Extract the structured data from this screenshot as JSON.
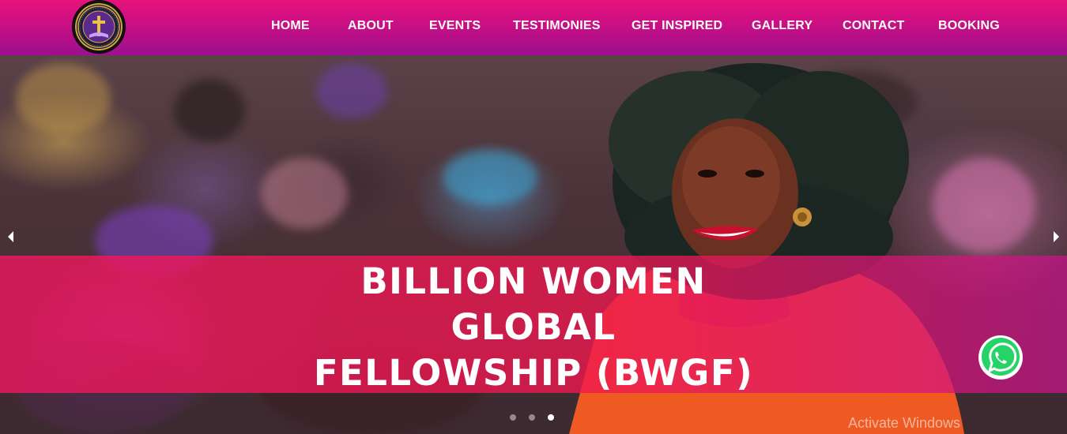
{
  "nav": {
    "items": [
      {
        "label": "HOME"
      },
      {
        "label": "ABOUT"
      },
      {
        "label": "EVENTS"
      },
      {
        "label": "TESTIMONIES"
      },
      {
        "label": "GET INSPIRED"
      },
      {
        "label": "GALLERY"
      },
      {
        "label": "CONTACT"
      },
      {
        "label": "BOOKING"
      }
    ]
  },
  "hero": {
    "caption_lines": [
      "BILLION WOMEN",
      "GLOBAL",
      "FELLOWSHIP (BWGF)"
    ],
    "slides_total": 3,
    "active_slide": 3
  },
  "watermark": "Activate Windows",
  "icons": {
    "logo": "bwgf-logo-icon",
    "prev": "chevron-left-icon",
    "next": "chevron-right-icon",
    "whatsapp": "whatsapp-icon"
  },
  "colors": {
    "header_top": "#e8127a",
    "header_bottom": "#9c0f8e",
    "caption_band": "#ec1860",
    "whatsapp_green": "#25d366"
  }
}
